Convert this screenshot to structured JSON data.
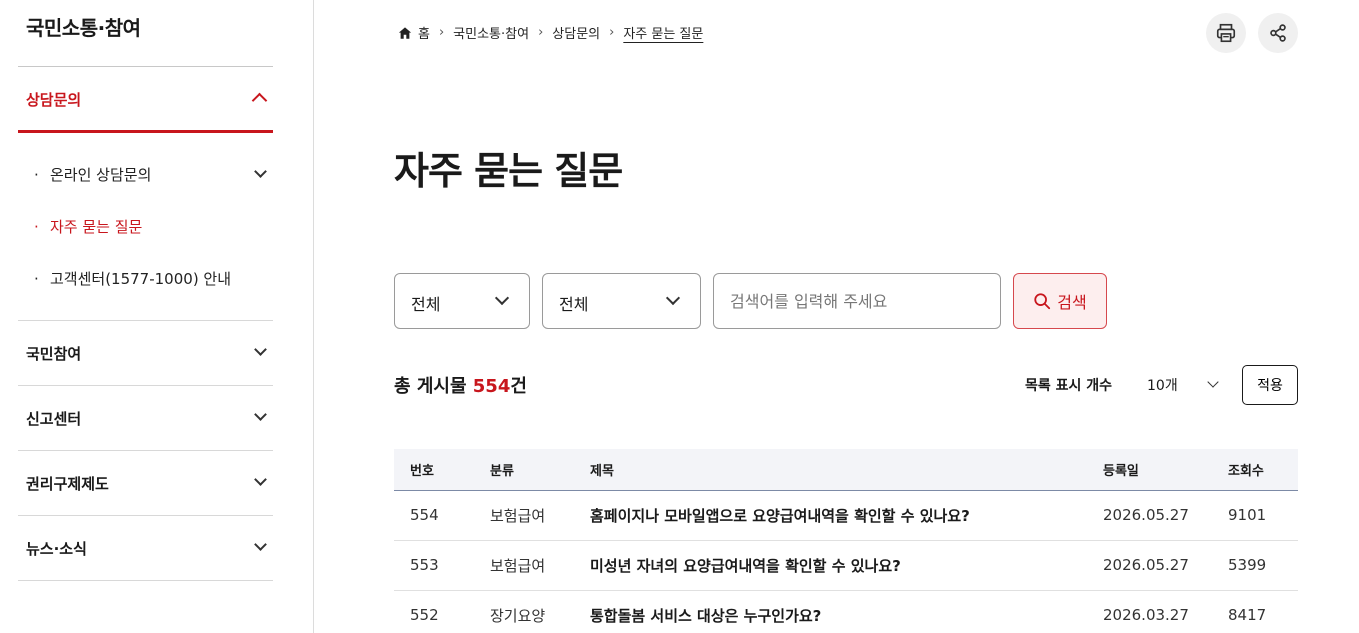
{
  "sidebar": {
    "title": "국민소통·참여",
    "active_section": "상담문의",
    "sub_items": [
      {
        "label": "온라인 상담문의"
      },
      {
        "label": "자주 묻는 질문"
      },
      {
        "label": "고객센터(1577-1000) 안내"
      }
    ],
    "groups": [
      {
        "label": "국민참여"
      },
      {
        "label": "신고센터"
      },
      {
        "label": "권리구제제도"
      },
      {
        "label": "뉴스·소식"
      }
    ]
  },
  "breadcrumb": {
    "home": "홈",
    "items": [
      "국민소통·참여",
      "상담문의",
      "자주 묻는 질문"
    ]
  },
  "page": {
    "title": "자주 묻는 질문"
  },
  "search": {
    "select1": "전체",
    "select2": "전체",
    "placeholder": "검색어를 입력해 주세요",
    "button": "검색"
  },
  "summary": {
    "prefix": "총 게시물 ",
    "count": "554",
    "suffix": "건",
    "list_label": "목록 표시 개수",
    "list_value": "10개",
    "apply": "적용"
  },
  "table": {
    "headers": [
      "번호",
      "분류",
      "제목",
      "등록일",
      "조회수"
    ],
    "rows": [
      [
        "554",
        "보험급여",
        "홈페이지나 모바일앱으로 요양급여내역을 확인할 수 있나요?",
        "2026.05.27",
        "9101"
      ],
      [
        "553",
        "보험급여",
        "미성년 자녀의 요양급여내역을 확인할 수 있나요?",
        "2026.05.27",
        "5399"
      ],
      [
        "552",
        "장기요양",
        "통합돌봄 서비스 대상은 누구인가요?",
        "2026.03.27",
        "8417"
      ]
    ]
  },
  "colors": {
    "accent": "#c8161d",
    "search_bg": "#fdeeee",
    "table_header_bg": "#f3f4f8"
  },
  "icons": [
    "home-icon",
    "print-icon",
    "share-icon",
    "search-icon",
    "chevron-down-icon",
    "chevron-up-icon"
  ]
}
